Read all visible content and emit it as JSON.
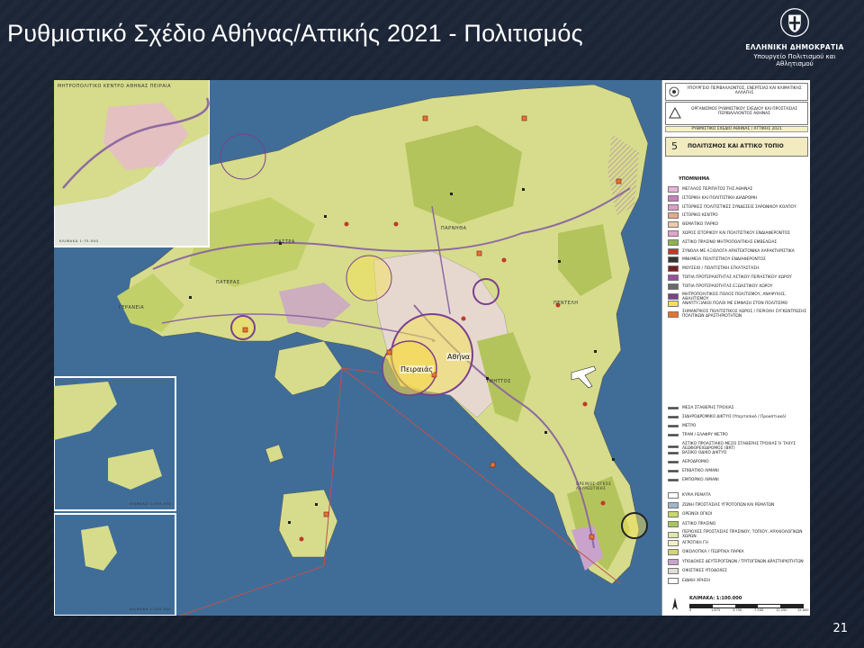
{
  "title": "Ρυθμιστικό Σχέδιο Αθήνας/Αττικής 2021 - Πολιτισμός",
  "logo": {
    "emblem_icon": "hellenic-republic-emblem-icon",
    "line1": "ΕΛΛΗΝΙΚΗ ΔΗΜΟΚΡΑΤΙΑ",
    "line2": "Υπουργείο Πολιτισμού και Αθλητισμού"
  },
  "page_number": "21",
  "map": {
    "cities": [
      "Αθήνα",
      "Πειραιάς"
    ],
    "region_labels": [
      "ΠΑΣΤΡΑ",
      "ΠΑΡΝΗΘΑ",
      "ΓΕΡΑΝΕΙΑ",
      "ΠΑΤΕΡΑΣ",
      "ΠΕΝΤΕΛΗ",
      "ΥΜΗΤΤΟΣ",
      "ΟΡΕΙΝΟΣ ΟΓΚΟΣ ΛΑΥΡΕΩΤΙΚΗΣ"
    ],
    "inset_top_label": "ΜΗΤΡΟΠΟΛΙΤΙΚΟ ΚΕΝΤΡΟ ΑΘΗΝΑΣ ΠΕΙΡΑΙΑ",
    "inset_scales": [
      "ΚΛΙΜΑΚΑ 1:75.000",
      "ΚΛΙΜΑΚΑ 1:250.000",
      "ΚΛΙΜΑΚΑ 1:250.000"
    ]
  },
  "legend": {
    "org1": "ΥΠΟΥΡΓΕΙΟ ΠΕΡΙΒΑΛΛΟΝΤΟΣ, ΕΝΕΡΓΕΙΑΣ ΚΑΙ ΚΛΙΜΑΤΙΚΗΣ ΑΛΛΑΓΗΣ",
    "org2": "ΟΡΓΑΝΙΣΜΟΣ ΡΥΘΜΙΣΤΙΚΟΥ ΣΧΕΔΙΟΥ ΚΑΙ ΠΡΟΣΤΑΣΙΑΣ ΠΕΡΙΒΑΛΛΟΝΤΟΣ ΑΘΗΝΑΣ",
    "plan": "ΡΥΘΜΙΣΤΙΚΟ ΣΧΕΔΙΟ ΑΘΗΝΑΣ / ΑΤΤΙΚΗΣ 2021",
    "sheet_number": "5",
    "sheet_title": "ΠΟΛΙΤΙΣΜΟΣ ΚΑΙ ΑΤΤΙΚΟ ΤΟΠΙΟ",
    "heading": "ΥΠΟΜΝΗΜΑ",
    "items": [
      {
        "label": "ΜΕΓΑΛΟΣ ΠΕΡΙΠΑΤΟΣ ΤΗΣ ΑΘΗΝΑΣ",
        "color": "#e9b4d9"
      },
      {
        "label": "ΙΣΤΟΡΙΚΗ ΚΑΙ ΠΟΛΙΤΙΣΤΙΚΗ ΔΙΑΔΡΟΜΗ",
        "color": "#c77fc0"
      },
      {
        "label": "ΙΣΤΟΡΙΚΕΣ ΠΟΛΙΤΙΣΤΙΚΕΣ ΣΥΝΔΕΣΕΙΣ ΣΑΡΩΝΙΚΟΥ ΚΟΛΠΟΥ",
        "color": "#d9a0c8"
      },
      {
        "label": "ΙΣΤΟΡΙΚΟ ΚΕΝΤΡΟ",
        "color": "#e6a98a"
      },
      {
        "label": "ΘΕΜΑΤΙΚΟ ΠΑΡΚΟ",
        "color": "#f1c9a8"
      },
      {
        "label": "ΧΩΡΟΣ ΙΣΤΟΡΙΚΟΥ ΚΑΙ ΠΟΛΙΤΙΣΤΙΚΟΥ ΕΝΔΙΑΦΕΡΟΝΤΟΣ",
        "color": "#e3a3c9"
      },
      {
        "label": "ΑΣΤΙΚΟ ΠΡΑΣΙΝΟ ΜΗΤΡΟΠΟΛΙΤΙΚΗΣ ΕΜΒΕΛΕΙΑΣ",
        "color": "#8fb34a"
      },
      {
        "label": "ΣΥΝΟΛΑ ΜΕ ΑΞΙΟΛΟΓΑ ΑΡΧΙΤΕΚΤΟΝΙΚΑ ΧΑΡΑΚΤΗΡΙΣΤΙΚΑ",
        "color": "#c0392b"
      },
      {
        "label": "ΜΝΗΜΕΙΑ ΠΟΛΙΤΙΣΤΙΚΟΥ ΕΝΔΙΑΦΕΡΟΝΤΟΣ",
        "color": "#333333"
      },
      {
        "label": "ΜΟΥΣΕΙΟ / ΠΟΛΙΤΙΣΤΙΚΗ ΕΓΚΑΤΑΣΤΑΣΗ",
        "color": "#7a1f1f"
      },
      {
        "label": "ΤΟΠΙΑ ΠΡΟΤΕΡΑΙΟΤΗΤΑΣ ΑΣΤΙΚΟΥ ΠΕΡΙΑΣΤΙΚΟΥ ΧΩΡΟΥ",
        "color": "#9b4fa0"
      },
      {
        "label": "ΤΟΠΙΑ ΠΡΟΤΕΡΑΙΟΤΗΤΑΣ ΕΞΩΑΣΤΙΚΟΥ ΧΩΡΟΥ",
        "color": "#6a6a6a"
      },
      {
        "label": "ΜΗΤΡΟΠΟΛΙΤΙΚΟΣ ΠΟΛΟΣ ΠΟΛΙΤΙΣΜΟΥ, ΑΝΑΨΥΧΗΣ, ΑΘΛΗΤΙΣΜΟΥ",
        "color": "#7b3f8f"
      },
      {
        "label": "ΑΝΑΠΤΥΞΙΑΚΟΙ ΠΟΛΟΙ ΜΕ ΕΜΦΑΣΗ ΣΤΟΝ ΠΟΛΙΤΙΣΜΟ",
        "color": "#f3e15a"
      },
      {
        "label": "ΣΗΜΑΝΤΙΚΟΣ ΠΟΛΙΤΙΣΤΙΚΟΣ ΧΩΡΟΣ / ΠΕΡΙΟΧΗ ΣΥΓΚΕΝΤΡΩΣΗΣ ΠΟΛΙΤΙΚΩΝ ΔΡΑΣΤΗΡΙΟΤΗΤΩΝ",
        "color": "#e8742c"
      }
    ],
    "transport_items": [
      "ΜΕΣΑ ΣΤΑΘΕΡΗΣ ΤΡΟΧΙΑΣ",
      "ΣΙΔΗΡΟΔΡΟΜΙΚΟ ΔΙΚΤΥΟ (Υπερτοπικό / Προαστιακό)",
      "ΜΕΤΡΟ",
      "ΤΡΑΜ / ΕΛΑΦΡΥ ΜΕΤΡΟ",
      "ΑΣΤΙΚΟ ΠΡΟΑΣΤΙΑΚΟ ΜΕΣΟ ΣΤΑΘΕΡΗΣ ΤΡΟΧΙΑΣ Ή ΤΑΧΥΣ ΛΕΩΦΟΡΕΙΟΔΡΟΜΟΣ (BRT)",
      "ΒΑΣΙΚΟ ΟΔΙΚΟ ΔΙΚΤΥΟ",
      "ΑΕΡΟΔΡΟΜΙΟ",
      "ΕΠΙΒΑΤΙΚΟ ΛΙΜΑΝΙ",
      "ΕΜΠΟΡΙΚΟ ΛΙΜΑΝΙ"
    ],
    "landuse_items": [
      {
        "label": "ΚΥΡΙΑ ΡΕΜΑΤΑ",
        "color": "#ffffff"
      },
      {
        "label": "ΖΩΝΗ ΠΡΟΣΤΑΣΙΑΣ ΥΓΡΟΤΟΠΩΝ ΚΑΙ ΡΕΜΑΤΩΝ",
        "color": "#9fb6cc"
      },
      {
        "label": "ΟΡΕΙΝΟΙ ΟΓΚΟΙ",
        "color": "#c6d96a"
      },
      {
        "label": "ΑΣΤΙΚΟ ΠΡΑΣΙΝΟ",
        "color": "#a6c85a"
      },
      {
        "label": "ΠΕΡΙΟΧΕΣ ΠΡΟΣΤΑΣΙΑΣ ΠΡΑΣΙΝΟΥ, ΤΟΠΙΟΥ, ΑΡΧΑΙΟΛΟΓΙΚΩΝ ΧΩΡΩΝ",
        "color": "#dfe9a9"
      },
      {
        "label": "ΑΓΡΟΤΙΚΗ ΓΗ",
        "color": "#f3f0c9"
      },
      {
        "label": "ΟΙΚΟΛΟΓΙΚΑ / ΓΕΩΡΓΙΚΑ ΠΑΡΚΑ",
        "color": "#d8d27a"
      },
      {
        "label": "ΥΠΟΔΟΧΕΣ ΔΕΥΤΕΡΟΓΕΝΩΝ / ΤΡΙΤΟΓΕΝΩΝ ΔΡΑΣΤΗΡΙΟΤΗΤΩΝ",
        "color": "#c9a3cc"
      },
      {
        "label": "ΟΙΚΙΣΤΙΚΕΣ ΥΠΟΔΟΧΕΣ",
        "color": "#e2dcd6"
      },
      {
        "label": "ΕΙΔΙΚΗ ΧΡΗΣΗ",
        "color": "#ffffff"
      }
    ],
    "scale": "ΚΛΙΜΑΚΑ: 1:100.000",
    "scale_ticks": [
      "0",
      "1.875",
      "3.750",
      "7.500",
      "11.250",
      "15.000"
    ],
    "north_icon": "north-arrow-icon"
  }
}
